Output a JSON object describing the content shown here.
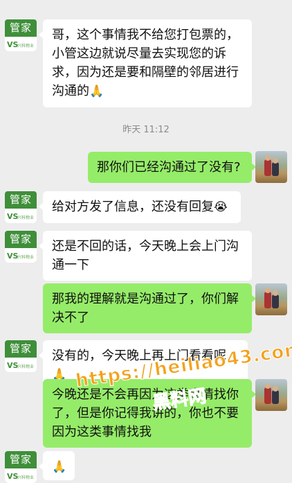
{
  "contact_label": "管家",
  "logo": {
    "mark": "VS",
    "text": "兴科物业"
  },
  "messages": [
    {
      "side": "left",
      "text": "哥，这个事情我不给您打包票的，小管这边就说尽量去实现您的诉求，因为还是要和隔壁的邻居进行沟通的",
      "emoji": "🙏"
    },
    {
      "side": "time",
      "text": "昨天 11:12"
    },
    {
      "side": "right",
      "text": "那你们已经沟通过了没有?"
    },
    {
      "side": "left",
      "text": "给对方发了信息，还没有回复",
      "emoji": "😭"
    },
    {
      "side": "left",
      "text": "还是不回的话，今天晚上会上门沟通一下"
    },
    {
      "side": "right",
      "text": "那我的理解就是沟通过了，你们解决不了"
    },
    {
      "side": "left",
      "text": "没有的，今天晚上再上门看看呢",
      "emoji": "🙏"
    },
    {
      "side": "right",
      "text": "今晚还是不会再因为这类事情找你了，但是你记得我讲的，你也不要因为这类事情找我"
    },
    {
      "side": "left",
      "text": "",
      "emoji": "🙏"
    }
  ],
  "watermark": {
    "url": "https://heiliao43.com",
    "brand": "黑料网"
  }
}
